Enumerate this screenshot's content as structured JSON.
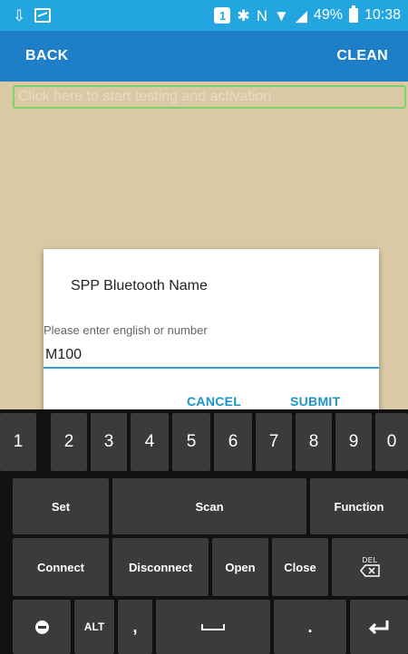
{
  "status_bar": {
    "notification_badge": "1",
    "battery_percent": "49%",
    "time": "10:38",
    "icons": [
      "download-icon",
      "image-icon",
      "notification-badge",
      "bluetooth-icon",
      "nfc-icon",
      "wifi-icon",
      "signal-icon",
      "battery-icon"
    ]
  },
  "app_bar": {
    "back_label": "BACK",
    "clean_label": "CLEAN",
    "color": "#1e7ec8"
  },
  "content": {
    "test_prompt": "Click here to start testing and activation",
    "background": "#d9c9a5"
  },
  "dialog": {
    "title": "SPP Bluetooth Name",
    "hint": "Please enter english or number",
    "input_value": "M100",
    "cancel_label": "CANCEL",
    "submit_label": "SUBMIT",
    "accent": "#1b94c8"
  },
  "keyboard": {
    "numbers": [
      "1",
      "2",
      "3",
      "4",
      "5",
      "6",
      "7",
      "8",
      "9",
      "0"
    ],
    "set_label": "Set",
    "scan_label": "Scan",
    "function_label": "Function",
    "connect_label": "Connect",
    "disconnect_label": "Disconnect",
    "open_label": "Open",
    "close_label": "Close",
    "del_label": "DEL",
    "alt_label": "ALT",
    "comma_label": ",",
    "period_label": "."
  }
}
